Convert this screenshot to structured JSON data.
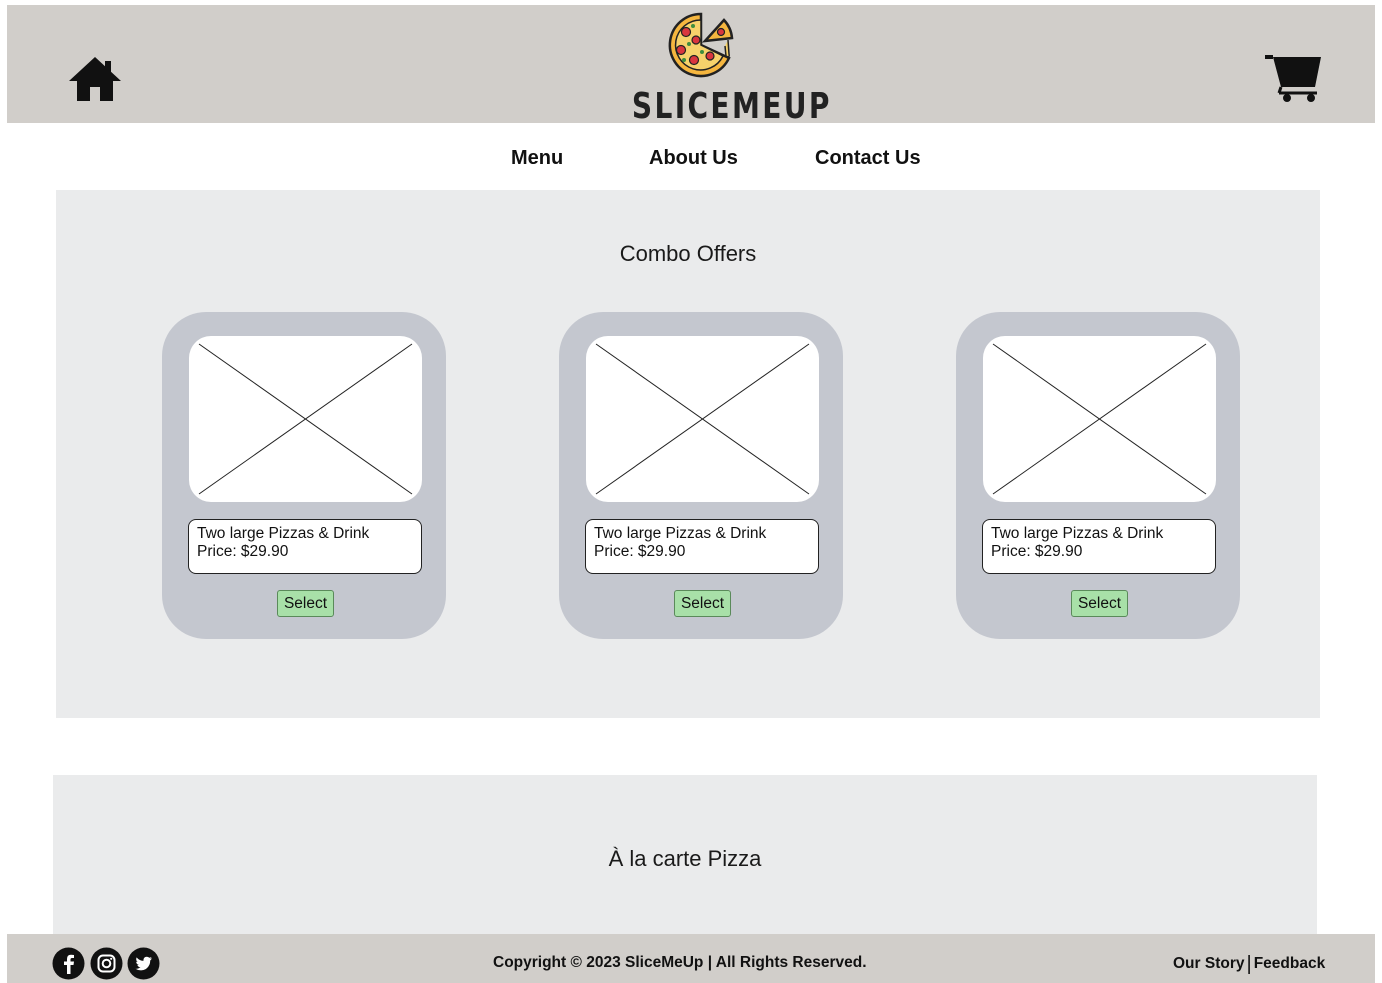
{
  "header": {
    "brand": "SLICEMEUP",
    "home_icon": "home-icon",
    "cart_icon": "cart-icon",
    "logo_icon": "pizza-icon"
  },
  "nav": {
    "items": [
      {
        "label": "Menu"
      },
      {
        "label": "About Us"
      },
      {
        "label": "Contact Us"
      }
    ]
  },
  "combo": {
    "title": "Combo Offers",
    "cards": [
      {
        "name": "Two large Pizzas & Drink",
        "price": "Price: $29.90",
        "button": "Select"
      },
      {
        "name": "Two large Pizzas & Drink",
        "price": "Price: $29.90",
        "button": "Select"
      },
      {
        "name": "Two large Pizzas & Drink",
        "price": "Price: $29.90",
        "button": "Select"
      }
    ]
  },
  "alacarte": {
    "title": "À la carte Pizza"
  },
  "footer": {
    "social": [
      "facebook-icon",
      "instagram-icon",
      "twitter-icon"
    ],
    "copyright": "Copyright © 2023 SliceMeUp | All Rights Reserved.",
    "links": [
      {
        "label": "Our Story"
      },
      {
        "label": "Feedback"
      }
    ],
    "separator": "|"
  },
  "colors": {
    "header_bg": "#d1ceca",
    "section_bg": "#eaebec",
    "card_bg": "#c4c7cf",
    "button_bg": "#a8e0a8"
  }
}
